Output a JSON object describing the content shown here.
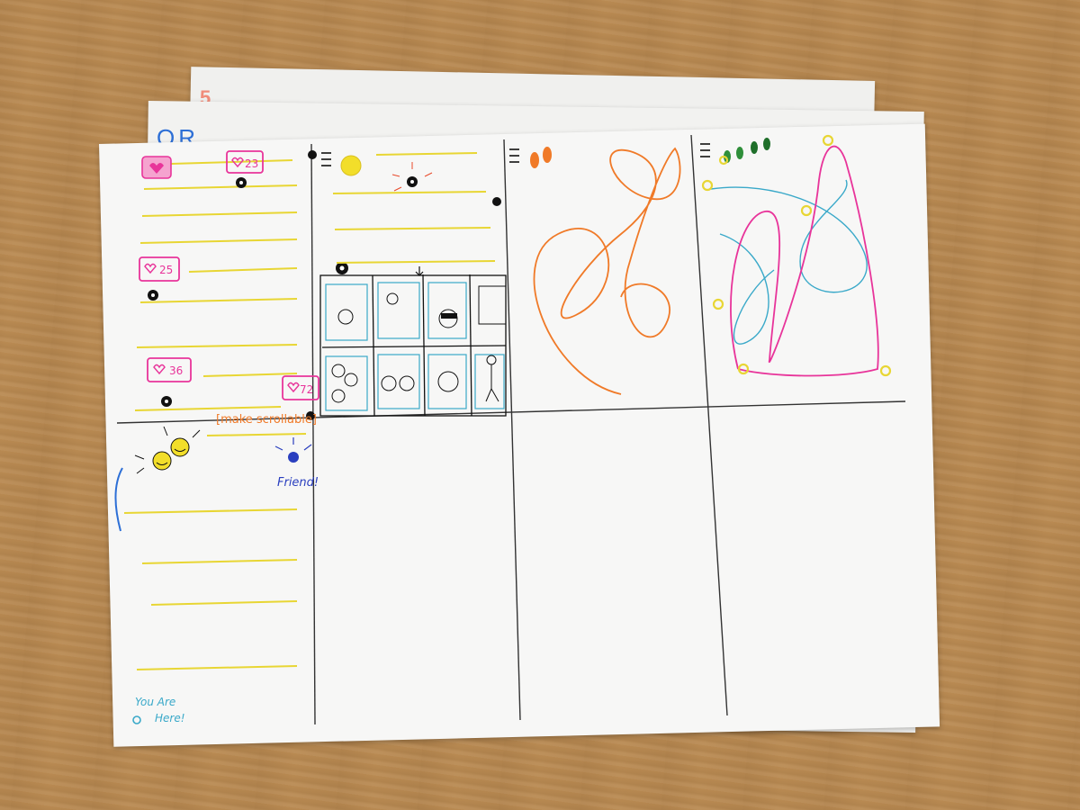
{
  "back_sheet_numbers": {
    "sheet1": "5",
    "sheet2": "OR"
  },
  "likes": [
    {
      "count": "23"
    },
    {
      "count": "25"
    },
    {
      "count": "36"
    },
    {
      "count": "72"
    }
  ],
  "notes": {
    "make_scrollable": "[make scrollable]",
    "friend": "Friend!",
    "you_are_here_1": "You Are",
    "you_are_here_2": "Here!"
  },
  "colors": {
    "pink": "#e8349a",
    "yellow": "#e8d634",
    "orange": "#f07a28",
    "cyan": "#3aa9c9",
    "blue": "#2a3fbf",
    "green": "#2f8f3a"
  }
}
